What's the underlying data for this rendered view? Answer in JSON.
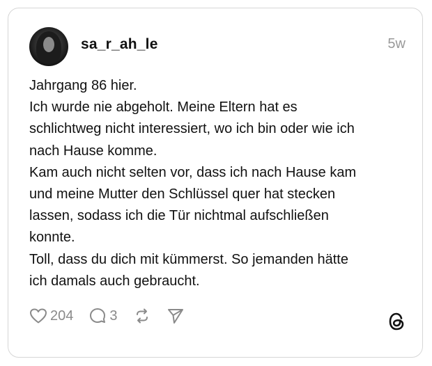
{
  "post": {
    "username": "sa_r_ah_le",
    "time": "5w",
    "lines": [
      "Jahrgang 86 hier.",
      "Ich wurde nie abgeholt. Meine Eltern hat es",
      "schlichtweg nicht interessiert, wo ich bin oder wie ich",
      "nach Hause komme.",
      "Kam auch nicht selten vor, dass ich nach Hause kam",
      "und meine Mutter den Schlüssel quer hat stecken",
      "lassen, sodass ich die Tür nichtmal aufschließen",
      "konnte.",
      "Toll, dass du dich mit kümmerst. So jemanden hätte",
      "ich damals auch gebraucht."
    ],
    "likes": "204",
    "replies": "3"
  },
  "icons": {
    "like": "heart-icon",
    "reply": "comment-icon",
    "repost": "repost-icon",
    "share": "send-icon",
    "brand": "threads-logo"
  }
}
